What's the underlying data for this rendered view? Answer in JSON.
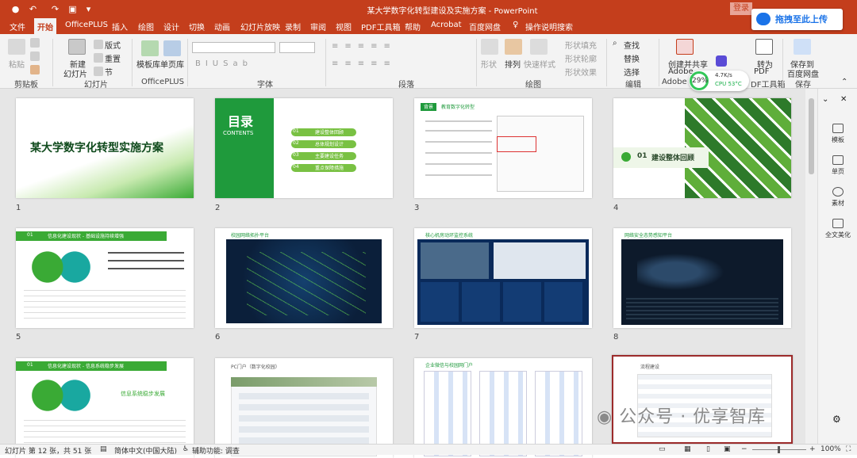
{
  "window": {
    "title": "某大学数字化转型建设及实施方案 - PowerPoint",
    "login_label": "登录",
    "upload_label": "拖拽至此上传"
  },
  "menu": {
    "file": "文件",
    "tabs": [
      "开始",
      "OfficePLUS",
      "插入",
      "绘图",
      "设计",
      "切换",
      "动画",
      "幻灯片放映",
      "录制",
      "审阅",
      "视图",
      "PDF工具箱",
      "帮助",
      "Acrobat",
      "百度网盘"
    ],
    "search": "操作说明搜索"
  },
  "ribbon": {
    "clipboard": {
      "paste": "粘贴",
      "label": "剪贴板"
    },
    "slides": {
      "new_slide": "新建",
      "new_slide2": "幻灯片",
      "layout": "版式",
      "reset": "重置",
      "section": "节",
      "label": "幻灯片"
    },
    "officeplus": {
      "template": "模板库",
      "single": "单页库",
      "label": "OfficePLUS"
    },
    "font": {
      "label": "字体"
    },
    "paragraph": {
      "label": "段落"
    },
    "drawing": {
      "shape": "形状",
      "arrange": "排列",
      "quick_style": "快速样式",
      "fill": "形状填充",
      "outline": "形状轮廓",
      "effect": "形状效果",
      "label": "绘图"
    },
    "editing": {
      "find": "查找",
      "replace": "替换",
      "select": "选择",
      "label": "编辑"
    },
    "adobe": {
      "create": "创建并共享",
      "adobe_pdf": "Adobe",
      "label": "Adobe"
    },
    "pdf": {
      "convert": "转为",
      "pdf_label": "PDF",
      "label": "DF工具箱"
    },
    "baidu": {
      "save": "保存到",
      "save2": "百度网盘",
      "label": "保存"
    }
  },
  "cpu": {
    "percent": "29%",
    "speed": "4.7K/s",
    "temp": "CPU 53°C"
  },
  "slides": [
    {
      "num": "1",
      "title": "某大学数字化转型实施方案"
    },
    {
      "num": "2",
      "title": "目录",
      "subtitle": "CONTENTS",
      "items": [
        "建设整体回顾",
        "总体规划设计",
        "主要建设任务",
        "重点保障措施"
      ],
      "item_nums": [
        "01",
        "02",
        "03",
        "04"
      ]
    },
    {
      "num": "3",
      "tag": "背景",
      "heading": "教育数字化转型"
    },
    {
      "num": "4",
      "section": "01",
      "heading": "建设整体回顾"
    },
    {
      "num": "5",
      "section": "01",
      "heading": "信息化建设现状 - 基础设施持续增强"
    },
    {
      "num": "6",
      "heading": "校园网络拓扑平台"
    },
    {
      "num": "7",
      "heading": "核心机房动环监控系统"
    },
    {
      "num": "8",
      "heading": "网络安全态势感知平台"
    },
    {
      "num": "9",
      "section": "01",
      "heading": "信息化建设现状 - 信息系统稳步发展",
      "caption": "信息系统稳步发展"
    },
    {
      "num": "10",
      "heading": "PC门户（数字化校园）"
    },
    {
      "num": "11",
      "heading": "企业微信与校园网门户"
    },
    {
      "num": "12",
      "heading": "流程建设"
    }
  ],
  "right_pane": [
    "模板",
    "单页",
    "素材",
    "全文美化"
  ],
  "status": {
    "slide_info": "幻灯片 第 12 张，共 51 张",
    "language": "简体中文(中国大陆)",
    "accessibility": "辅助功能: 调查",
    "zoom": "100%"
  },
  "watermark": "公众号 · 优享智库",
  "colors": {
    "accent": "#c43e1c",
    "green": "#3aaa35",
    "selection": "#9c2b2b"
  }
}
